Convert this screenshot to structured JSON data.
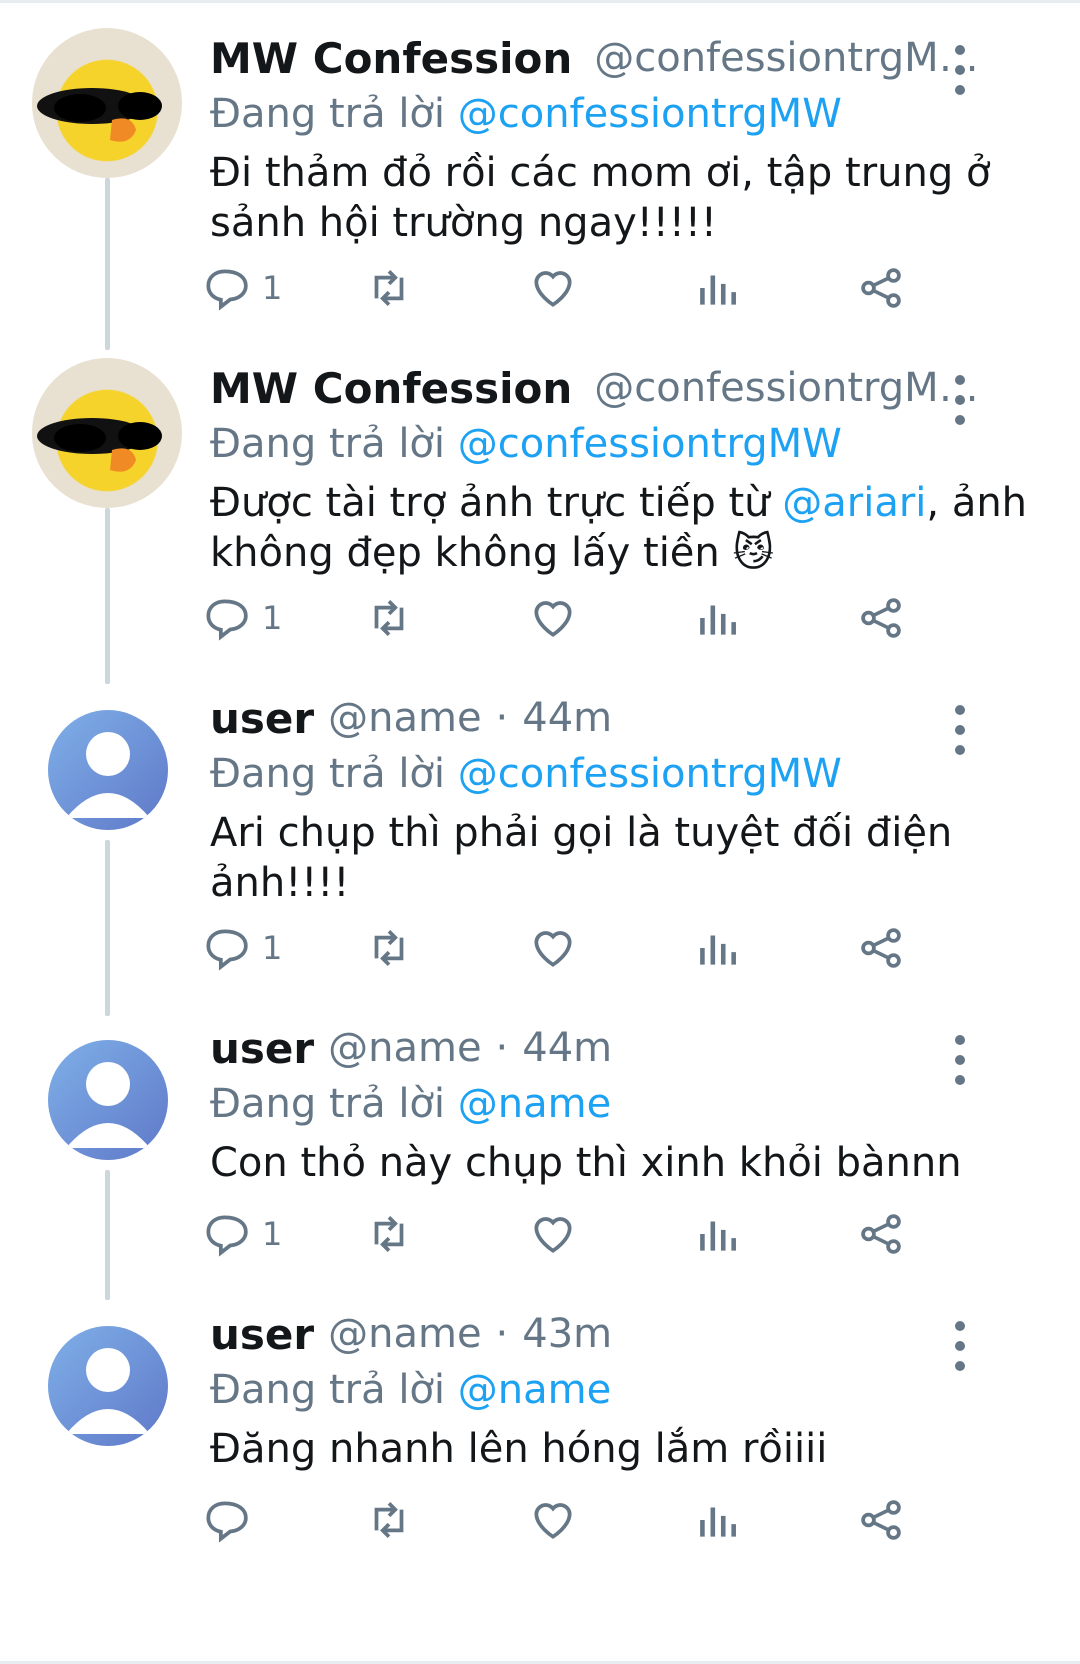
{
  "tweets": [
    {
      "name": "MW Confession",
      "handle": "@confessiontrgMW⋯",
      "time": "",
      "avatar": "duck",
      "reply_prefix": "Đang trả lời ",
      "reply_to": "@confessiontrgMW",
      "text_before": "Đi thảm đỏ rồi các mom ơi, tập trung ở sảnh hội trường ngay!!!!!",
      "text_mention": "",
      "text_after": "",
      "reply_count": "1"
    },
    {
      "name": "MW Confession",
      "handle": "@confessiontrgMW⋯",
      "time": "",
      "avatar": "duck",
      "reply_prefix": "Đang trả lời ",
      "reply_to": "@confessiontrgMW",
      "text_before": "Được tài trợ ảnh trực tiếp từ ",
      "text_mention": "@ariari",
      "text_after": ", ảnh không đẹp không lấy tiền 😼",
      "reply_count": "1"
    },
    {
      "name": "user",
      "handle": "@name",
      "time": "44m",
      "avatar": "user",
      "reply_prefix": "Đang trả lời ",
      "reply_to": "@confessiontrgMW",
      "text_before": "Ari chụp thì phải gọi là tuyệt đối điện ảnh!!!!",
      "text_mention": "",
      "text_after": "",
      "reply_count": "1"
    },
    {
      "name": "user",
      "handle": "@name",
      "time": "44m",
      "avatar": "user",
      "reply_prefix": "Đang trả lời ",
      "reply_to": "@name",
      "text_before": "Con thỏ này chụp thì xinh khỏi bànnn",
      "text_mention": "",
      "text_after": "",
      "reply_count": "1"
    },
    {
      "name": "user",
      "handle": "@name",
      "time": "43m",
      "avatar": "user",
      "reply_prefix": "Đang trả lời ",
      "reply_to": "@name",
      "text_before": "Đăng nhanh lên hóng lắm rồiiii",
      "text_mention": "",
      "text_after": "",
      "reply_count": ""
    }
  ],
  "time_separator": "·",
  "icons": [
    "reply-icon",
    "retweet-icon",
    "like-icon",
    "analytics-icon",
    "share-icon",
    "more-icon"
  ],
  "colors": {
    "link": "#1da1f2",
    "muted": "#657786",
    "text": "#14171a",
    "thread_line": "#ccd6dd"
  }
}
